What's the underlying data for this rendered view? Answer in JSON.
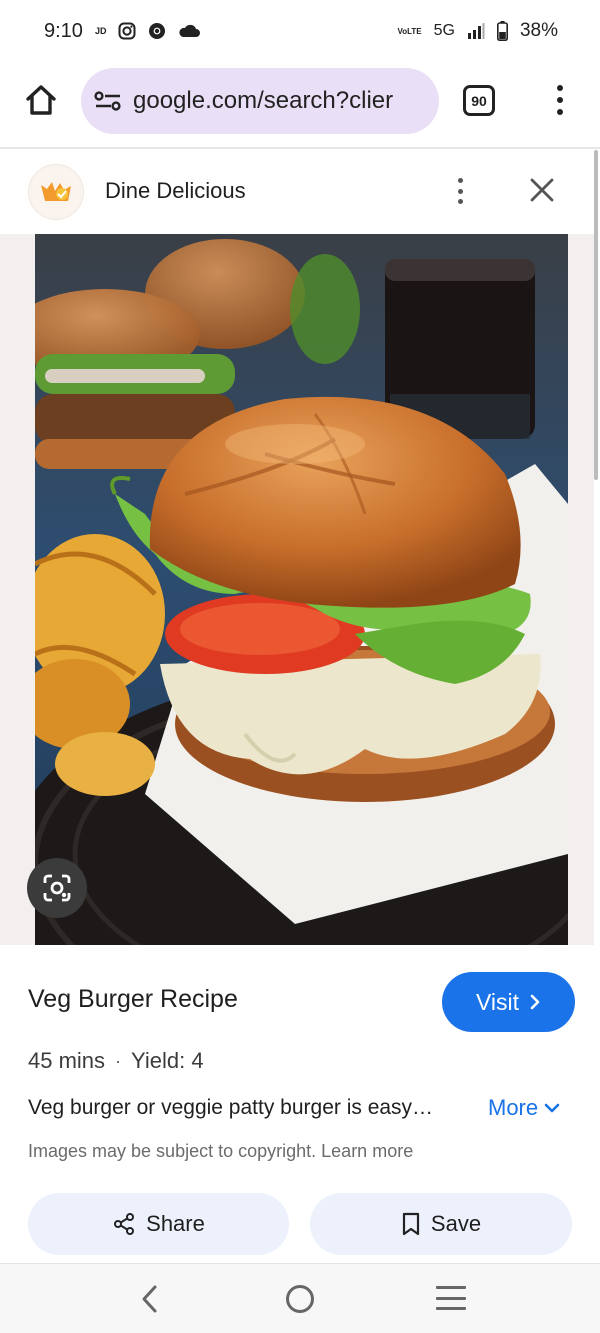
{
  "status_bar": {
    "time": "9:10",
    "carrier_tag": "JD",
    "network": "5G",
    "volte": "VoLTE",
    "battery": "38%"
  },
  "browser": {
    "url": "google.com/search?clier",
    "tab_count": "90"
  },
  "source": {
    "name": "Dine Delicious"
  },
  "result": {
    "title": "Veg Burger Recipe",
    "visit_label": "Visit",
    "time": "45 mins",
    "separator": "·",
    "yield": "Yield: 4",
    "description": "Veg burger or veggie patty burger is easy…",
    "more_label": "More",
    "copyright_text": "Images may be subject to copyright.",
    "learn_more": "Learn more",
    "share_label": "Share",
    "save_label": "Save"
  },
  "colors": {
    "accent": "#1a73e8",
    "url_pill": "#e9dff6",
    "action_button_bg": "#ecf1fc"
  }
}
